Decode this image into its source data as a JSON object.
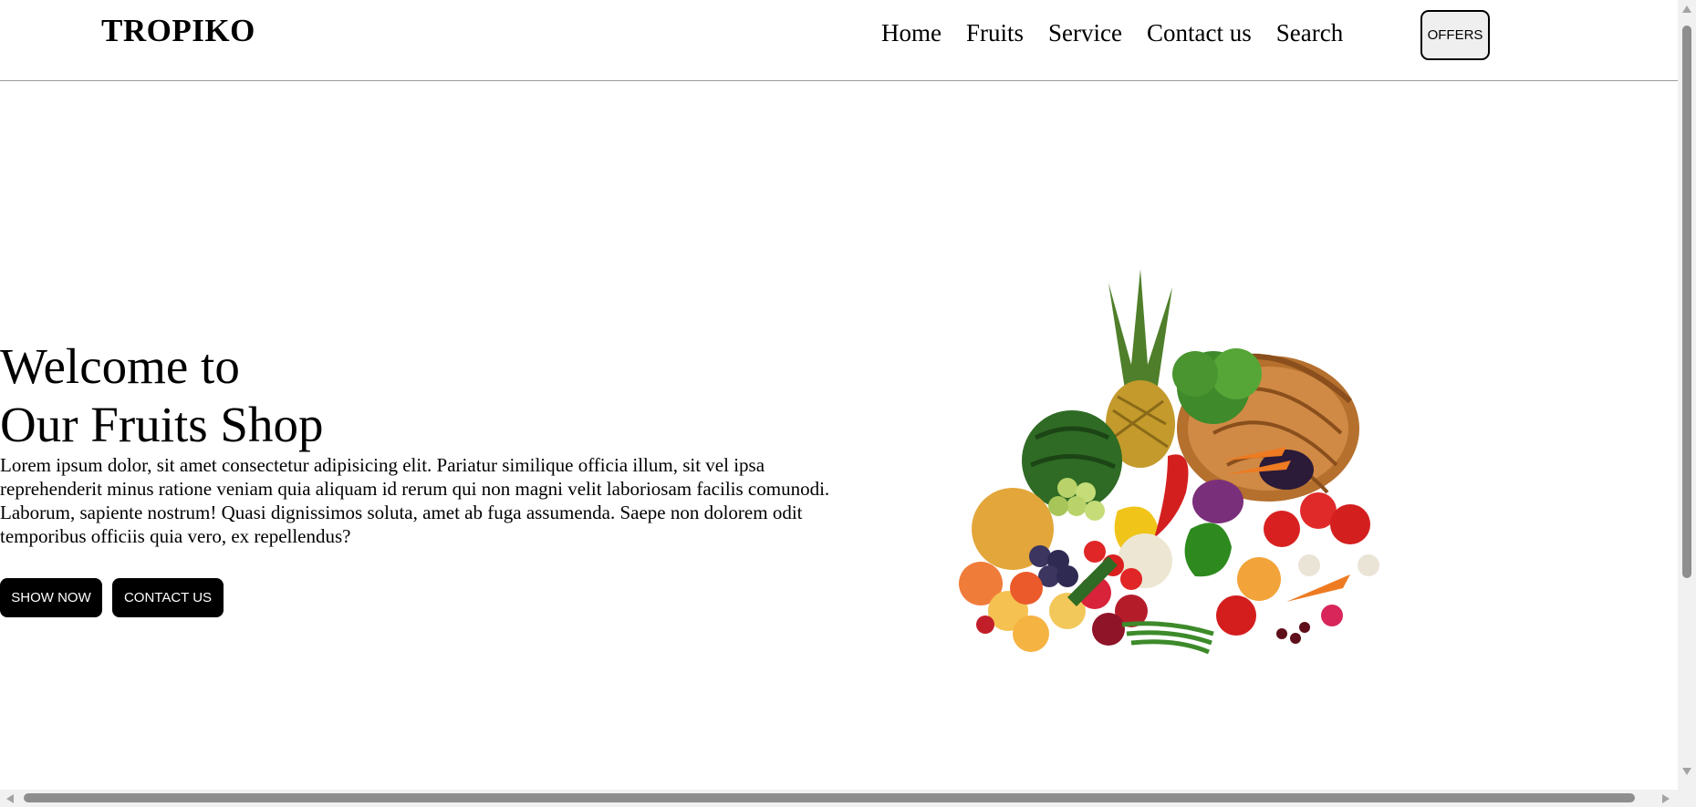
{
  "header": {
    "logo": "TROPIKO",
    "nav": [
      "Home",
      "Fruits",
      "Service",
      "Contact us",
      "Search"
    ],
    "offers_label": "OFFERS"
  },
  "hero": {
    "title_line1": "Welcome to",
    "title_line2": "Our Fruits Shop",
    "text": "Lorem ipsum dolor, sit amet consectetur adipisicing elit. Pariatur similique officia illum, sit vel ipsa reprehenderit minus ratione veniam quia aliquam id rerum qui non magni velit laboriosam facilis comunodi. Laborum, sapiente nostrum! Quasi dignissimos soluta, amet ab fuga assumenda. Saepe non dolorem odit temporibus officiis quia vero, ex repellendus?",
    "show_now_label": "SHOW NOW",
    "contact_us_label": "CONTACT US",
    "image_icon": "fruit-basket-icon"
  },
  "colors": {
    "button_bg": "#000000",
    "button_text": "#ffffff",
    "offers_bg": "#efefef",
    "divider": "#9a9a9a"
  }
}
